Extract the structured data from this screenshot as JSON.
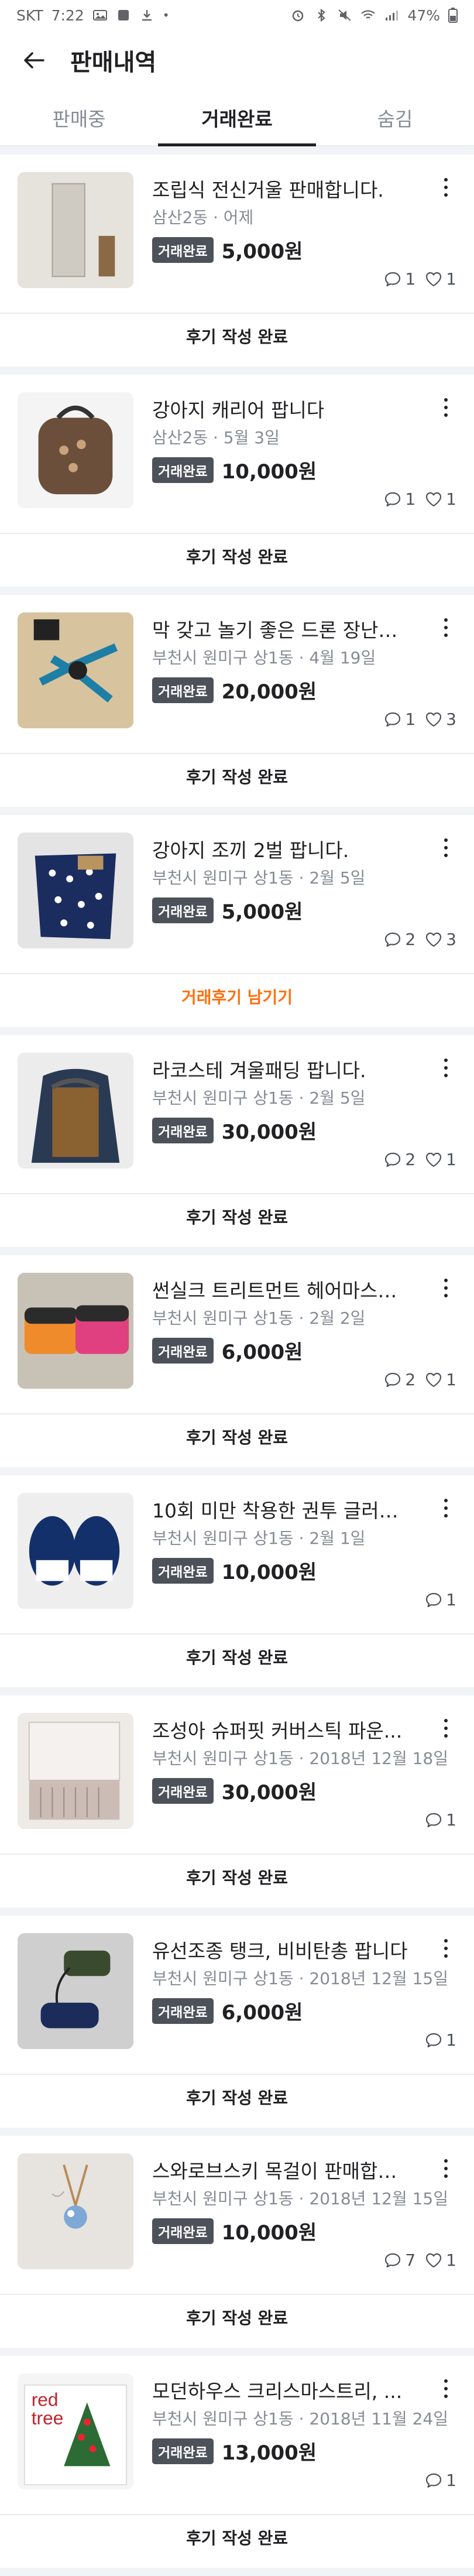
{
  "status_bar": {
    "carrier": "SKT",
    "time": "7:22",
    "battery": "47%"
  },
  "header": {
    "title": "판매내역"
  },
  "tabs": [
    {
      "label": "판매중",
      "active": false
    },
    {
      "label": "거래완료",
      "active": true
    },
    {
      "label": "숨김",
      "active": false
    }
  ],
  "items": [
    {
      "title": "조립식 전신거울 판매합니다.",
      "meta": "삼산2동 · 어제",
      "badge": "거래완료",
      "price": "5,000원",
      "comments": "1",
      "likes": "1",
      "action": "후기 작성 완료"
    },
    {
      "title": "강아지 캐리어 팝니다",
      "meta": "삼산2동 · 5월 3일",
      "badge": "거래완료",
      "price": "10,000원",
      "comments": "1",
      "likes": "1",
      "action": "후기 작성 완료"
    },
    {
      "title": "막 갖고 놀기 좋은 드론 장난감 ...",
      "meta": "부천시 원미구 상1동 · 4월 19일",
      "badge": "거래완료",
      "price": "20,000원",
      "comments": "1",
      "likes": "3",
      "action": "후기 작성 완료"
    },
    {
      "title": "강아지 조끼 2벌 팝니다.",
      "meta": "부천시 원미구 상1동 · 2월 5일",
      "badge": "거래완료",
      "price": "5,000원",
      "comments": "2",
      "likes": "3",
      "action": "거래후기 남기기"
    },
    {
      "title": "라코스테 겨울패딩 팝니다.",
      "meta": "부천시 원미구 상1동 · 2월 5일",
      "badge": "거래완료",
      "price": "30,000원",
      "comments": "2",
      "likes": "1",
      "action": "후기 작성 완료"
    },
    {
      "title": "썬실크 트리트먼트 헤어마스크...",
      "meta": "부천시 원미구 상1동 · 2월 2일",
      "badge": "거래완료",
      "price": "6,000원",
      "comments": "2",
      "likes": "1",
      "action": "후기 작성 완료"
    },
    {
      "title": "10회 미만 착용한 권투 글러브 ...",
      "meta": "부천시 원미구 상1동 · 2월 1일",
      "badge": "거래완료",
      "price": "10,000원",
      "comments": "1",
      "likes": null,
      "action": "후기 작성 완료"
    },
    {
      "title": "조성아 슈퍼핏 커버스틱 파운...",
      "meta": "부천시 원미구 상1동 · 2018년 12월 18일",
      "badge": "거래완료",
      "price": "30,000원",
      "comments": "1",
      "likes": null,
      "action": "후기 작성 완료"
    },
    {
      "title": "유선조종 탱크, 비비탄총 팝니다",
      "meta": "부천시 원미구 상1동 · 2018년 12월 15일",
      "badge": "거래완료",
      "price": "6,000원",
      "comments": "1",
      "likes": null,
      "action": "후기 작성 완료"
    },
    {
      "title": "스와로브스키 목걸이 판매합니...",
      "meta": "부천시 원미구 상1동 · 2018년 12월 15일",
      "badge": "거래완료",
      "price": "10,000원",
      "comments": "7",
      "likes": "1",
      "action": "후기 작성 완료"
    },
    {
      "title": "모던하우스 크리스마스트리, ...",
      "meta": "부천시 원미구 상1동 · 2018년 11월 24일",
      "badge": "거래완료",
      "price": "13,000원",
      "comments": "1",
      "likes": null,
      "action": "후기 작성 완료"
    }
  ],
  "colors": {
    "accent": "#ff6f0f",
    "badge_bg": "#4d5159",
    "divider": "#f2f3f6"
  }
}
